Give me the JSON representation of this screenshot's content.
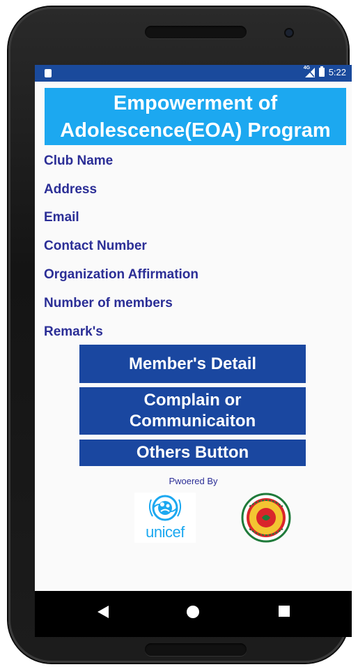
{
  "status_bar": {
    "network": "4G",
    "time": "5:22"
  },
  "app": {
    "title": "Empowerment of Adolescence(EOA) Program",
    "title_line1": "Empowerment of",
    "title_line2": "Adolescence(EOA) Program",
    "fields": [
      {
        "label": "Club Name"
      },
      {
        "label": "Address"
      },
      {
        "label": "Email"
      },
      {
        "label": "Contact Number"
      },
      {
        "label": "Organization Affirmation"
      },
      {
        "label": "Number of members"
      },
      {
        "label": "Remark's"
      }
    ],
    "buttons": {
      "members_detail": "Member's Detail",
      "complain_line1": "Complain or",
      "complain_line2": "Communicaiton",
      "others": "Others Button"
    },
    "powered_by": "Pwoered By",
    "logos": {
      "unicef_text": "unicef",
      "unicef_icon": "unicef-emblem",
      "govt_icon": "bangladesh-government-seal"
    }
  },
  "navigation": {
    "back_icon": "back-triangle-icon",
    "home_icon": "home-circle-icon",
    "recents_icon": "recents-square-icon"
  },
  "colors": {
    "status_bar": "#1a4a9c",
    "title_banner": "#1ca8f0",
    "field_text": "#2b2e96",
    "button_bg": "#1a47a0",
    "background": "#fafafa"
  }
}
